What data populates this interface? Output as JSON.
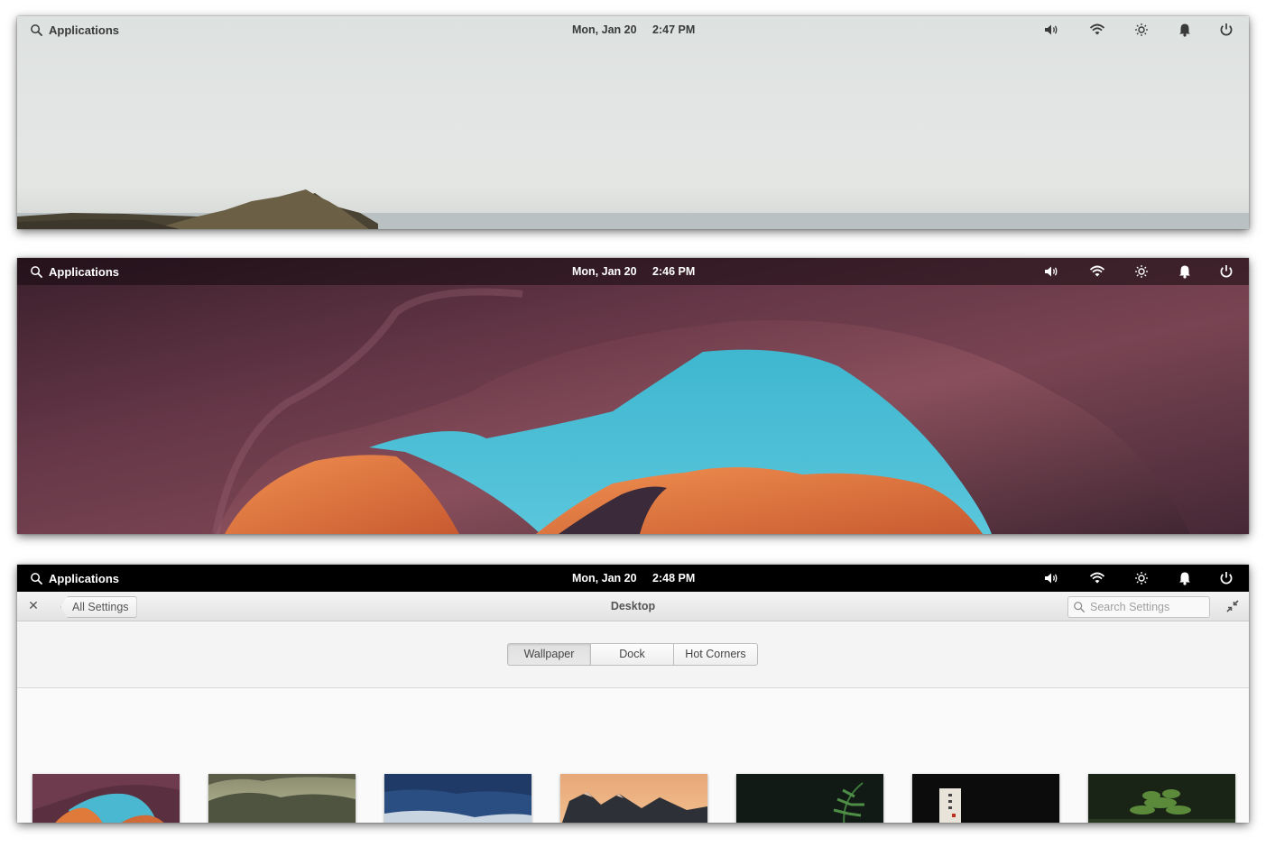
{
  "screens": [
    {
      "panel": {
        "applications_label": "Applications",
        "date": "Mon, Jan 20",
        "time": "2:47 PM"
      },
      "wallpaper": "misty-seascape"
    },
    {
      "panel": {
        "applications_label": "Applications",
        "date": "Mon, Jan 20",
        "time": "2:46 PM"
      },
      "wallpaper": "canyon-arch"
    },
    {
      "panel": {
        "applications_label": "Applications",
        "date": "Mon, Jan 20",
        "time": "2:48 PM"
      },
      "wallpaper": "settings-window"
    }
  ],
  "indicators": [
    "volume-icon",
    "wifi-icon",
    "brightness-icon",
    "notifications-icon",
    "power-icon"
  ],
  "settings": {
    "back_label": "All Settings",
    "title": "Desktop",
    "search_placeholder": "Search Settings",
    "tabs": [
      {
        "label": "Wallpaper",
        "active": true
      },
      {
        "label": "Dock",
        "active": false
      },
      {
        "label": "Hot Corners",
        "active": false
      }
    ],
    "wallpapers": [
      "canyon",
      "misty-hills",
      "ocean-waves",
      "mountain-sunset",
      "fern-dark",
      "dark-sign",
      "green-plant"
    ]
  },
  "colors": {
    "panel_black": "#000000",
    "sky_blue": "#3fb7cf",
    "canyon_orange": "#e07a3a"
  }
}
